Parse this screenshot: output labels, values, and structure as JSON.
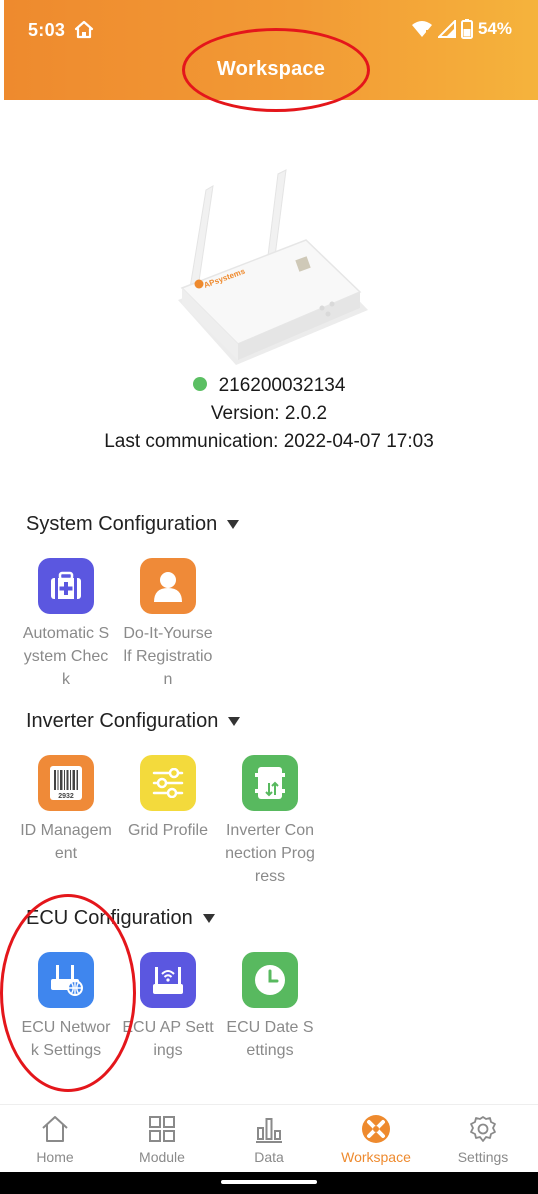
{
  "status": {
    "time": "5:03",
    "battery": "54%"
  },
  "header": {
    "title": "Workspace"
  },
  "device": {
    "serial": "216200032134",
    "version": "Version: 2.0.2",
    "last_comm": "Last communication: 2022-04-07 17:03",
    "brand": "APsystems",
    "online_color": "#5bbf63"
  },
  "sections": [
    {
      "title": "System Configuration",
      "items": [
        {
          "label": "Automatic System Check",
          "icon": "medical-kit-icon",
          "color": "#5b57e0"
        },
        {
          "label": "Do-It-Yourself Registration",
          "icon": "person-icon",
          "color": "#ef8a38"
        }
      ]
    },
    {
      "title": "Inverter Configuration",
      "items": [
        {
          "label": "ID Management",
          "icon": "barcode-icon",
          "color": "#ef8a38"
        },
        {
          "label": "Grid Profile",
          "icon": "sliders-icon",
          "color": "#f3da3c"
        },
        {
          "label": "Inverter Connection Progress",
          "icon": "inverter-icon",
          "color": "#58b95f"
        }
      ]
    },
    {
      "title": "ECU Configuration",
      "items": [
        {
          "label": "ECU Network Settings",
          "icon": "router-globe-icon",
          "color": "#3f86ee"
        },
        {
          "label": "ECU AP Settings",
          "icon": "router-wifi-icon",
          "color": "#5b57e0"
        },
        {
          "label": "ECU Date Settings",
          "icon": "clock-icon",
          "color": "#58b95f"
        }
      ]
    }
  ],
  "barcode_text": "2932",
  "tabs": [
    {
      "label": "Home",
      "icon": "home-icon"
    },
    {
      "label": "Module",
      "icon": "grid-icon"
    },
    {
      "label": "Data",
      "icon": "bar-chart-icon"
    },
    {
      "label": "Workspace",
      "icon": "workspace-icon",
      "active": true
    },
    {
      "label": "Settings",
      "icon": "gear-icon"
    }
  ],
  "colors": {
    "header_start": "#ee8a2e",
    "header_end": "#f5b33c",
    "accent": "#ee8a2e",
    "annotation": "#e4161b"
  }
}
